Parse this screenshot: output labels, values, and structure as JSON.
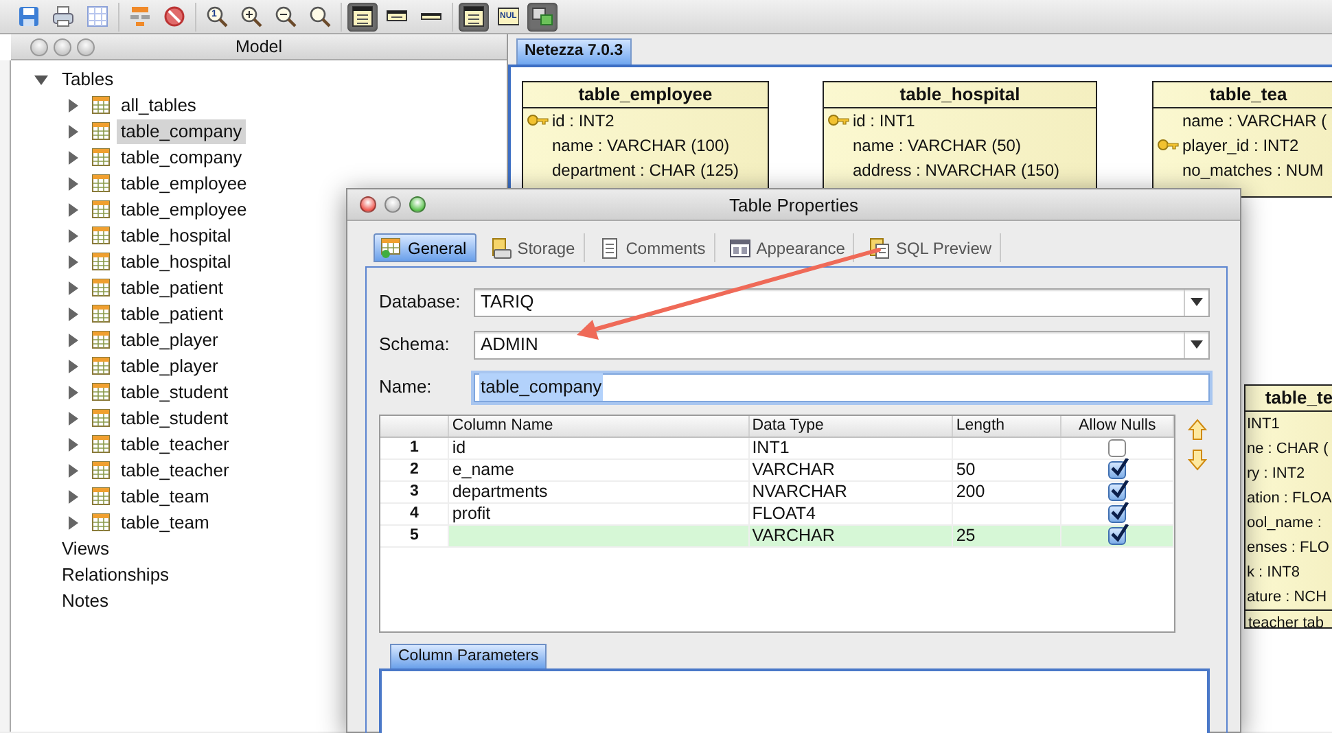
{
  "toolbar": [
    [
      {
        "kind": "save",
        "pressed": false
      },
      {
        "kind": "print",
        "pressed": false
      },
      {
        "kind": "grid",
        "pressed": false
      }
    ],
    [
      {
        "kind": "hierarchy",
        "pressed": false
      },
      {
        "kind": "forbid",
        "pressed": false
      }
    ],
    [
      {
        "kind": "zoom-actual",
        "label": "1",
        "pressed": false
      },
      {
        "kind": "zoom-in",
        "pressed": false
      },
      {
        "kind": "zoom-out",
        "pressed": false
      },
      {
        "kind": "zoom-fit",
        "pressed": false
      }
    ],
    [
      {
        "kind": "view-full",
        "pressed": true
      },
      {
        "kind": "view-compact",
        "pressed": false
      },
      {
        "kind": "view-title",
        "pressed": false
      }
    ],
    [
      {
        "kind": "view-full",
        "pressed": true
      },
      {
        "kind": "nul",
        "label": "NUL",
        "pressed": false
      },
      {
        "kind": "layout",
        "pressed": true
      }
    ]
  ],
  "model_panel": {
    "title": "Model",
    "tree": [
      {
        "label": "Tables",
        "expanded": true,
        "selected": false,
        "children": [
          {
            "label": "all_tables",
            "expanded": false,
            "selected": false
          },
          {
            "label": "table_company",
            "expanded": false,
            "selected": true
          },
          {
            "label": "table_company",
            "expanded": false,
            "selected": false
          },
          {
            "label": "table_employee",
            "expanded": false,
            "selected": false
          },
          {
            "label": "table_employee",
            "expanded": false,
            "selected": false
          },
          {
            "label": "table_hospital",
            "expanded": false,
            "selected": false
          },
          {
            "label": "table_hospital",
            "expanded": false,
            "selected": false
          },
          {
            "label": "table_patient",
            "expanded": false,
            "selected": false
          },
          {
            "label": "table_patient",
            "expanded": false,
            "selected": false
          },
          {
            "label": "table_player",
            "expanded": false,
            "selected": false
          },
          {
            "label": "table_player",
            "expanded": false,
            "selected": false
          },
          {
            "label": "table_student",
            "expanded": false,
            "selected": false
          },
          {
            "label": "table_student",
            "expanded": false,
            "selected": false
          },
          {
            "label": "table_teacher",
            "expanded": false,
            "selected": false
          },
          {
            "label": "table_teacher",
            "expanded": false,
            "selected": false
          },
          {
            "label": "table_team",
            "expanded": false,
            "selected": false
          },
          {
            "label": "table_team",
            "expanded": false,
            "selected": false
          }
        ]
      },
      {
        "label": "Views",
        "selected": false
      },
      {
        "label": "Relationships",
        "selected": false
      },
      {
        "label": "Notes",
        "selected": false
      }
    ]
  },
  "diagram": {
    "tabs": [
      {
        "label": "Netezza 7.0.3",
        "selected": true
      }
    ],
    "entities": [
      {
        "title": "table_employee",
        "rows": [
          {
            "text": "id : INT2",
            "key": true
          },
          {
            "text": "name : VARCHAR (100)",
            "key": false
          },
          {
            "text": "department : CHAR (125)",
            "key": false
          }
        ]
      },
      {
        "title": "table_hospital",
        "rows": [
          {
            "text": "id : INT1",
            "key": true
          },
          {
            "text": "name : VARCHAR (50)",
            "key": false
          },
          {
            "text": "address : NVARCHAR (150)",
            "key": false
          }
        ]
      },
      {
        "title": "table_tea",
        "rows": [
          {
            "text": "name : VARCHAR (",
            "key": false
          },
          {
            "text": "player_id : INT2",
            "key": true
          },
          {
            "text": "no_matches : NUM",
            "key": false
          }
        ]
      },
      {
        "title": "table_te",
        "rows": [
          {
            "text": "INT1",
            "key": false
          },
          {
            "text": "ne : CHAR (",
            "key": false
          },
          {
            "text": "ry : INT2",
            "key": false
          },
          {
            "text": "ation : FLOA",
            "key": false
          },
          {
            "text": "ool_name :",
            "key": false
          },
          {
            "text": "enses : FLO",
            "key": false
          },
          {
            "text": "k : INT8",
            "key": false
          },
          {
            "text": "ature : NCH",
            "key": false
          }
        ],
        "footer": "teacher tab"
      }
    ]
  },
  "dialog": {
    "title": "Table Properties",
    "tabs": [
      {
        "label": "General",
        "kind": "general",
        "selected": true
      },
      {
        "label": "Storage",
        "kind": "storage",
        "selected": false
      },
      {
        "label": "Comments",
        "kind": "comments",
        "selected": false
      },
      {
        "label": "Appearance",
        "kind": "appearance",
        "selected": false
      },
      {
        "label": "SQL Preview",
        "kind": "sql",
        "selected": false
      }
    ],
    "database": {
      "label": "Database:",
      "value": "TARIQ"
    },
    "schema": {
      "label": "Schema:",
      "value": "ADMIN"
    },
    "name": {
      "label": "Name:",
      "value": "table_company",
      "text_selected": true
    },
    "columns_table": {
      "columns": [
        "Column Name",
        "Data Type",
        "Length",
        "Allow Nulls"
      ],
      "rows": [
        {
          "number": "1",
          "name": "id",
          "type": "INT1",
          "allow_nulls": false,
          "selected": false
        },
        {
          "number": "2",
          "name": "e_name",
          "type": "VARCHAR",
          "length": "50",
          "allow_nulls": true,
          "selected": false
        },
        {
          "number": "3",
          "name": "departments",
          "type": "NVARCHAR",
          "length": "200",
          "allow_nulls": true,
          "selected": false
        },
        {
          "number": "4",
          "name": "profit",
          "type": "FLOAT4",
          "allow_nulls": true,
          "selected": false
        },
        {
          "number": "5",
          "type": "VARCHAR",
          "length": "25",
          "allow_nulls": true,
          "selected": true
        }
      ]
    },
    "column_parameters": {
      "tab": "Column Parameters"
    }
  }
}
